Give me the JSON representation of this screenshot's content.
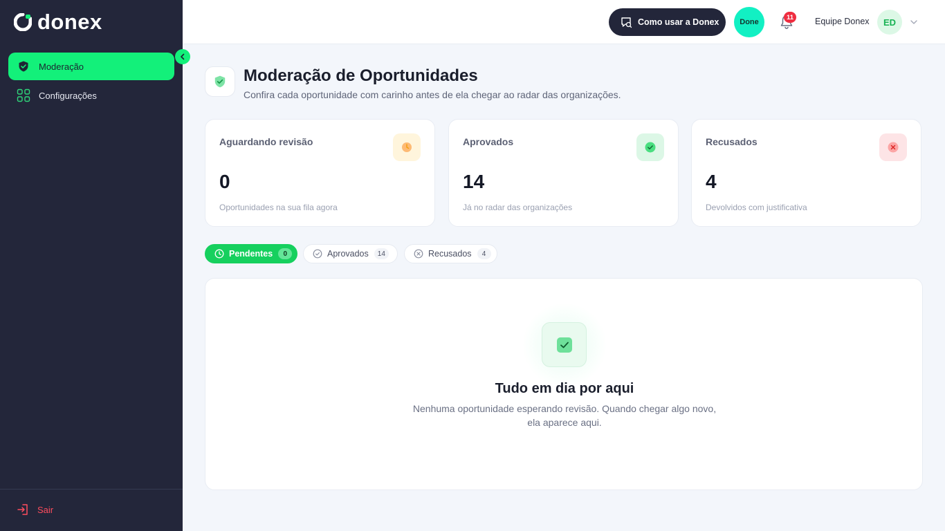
{
  "brand": {
    "name": "donex",
    "accent": "#13f07a",
    "sidebar_bg": "#23263a"
  },
  "sidebar": {
    "items": [
      {
        "label": "Moderação",
        "icon": "shield-check-icon",
        "active": true
      },
      {
        "label": "Configurações",
        "icon": "grid-icon",
        "active": false
      }
    ],
    "logout_label": "Sair"
  },
  "topbar": {
    "howto_label": "Como usar a Donex",
    "done_label": "Done",
    "notifications_count": "11",
    "team_name": "Equipe Donex",
    "team_initials": "ED"
  },
  "page": {
    "title": "Moderação de Oportunidades",
    "subtitle": "Confira cada oportunidade com carinho antes de ela chegar ao radar das organizações."
  },
  "stats": [
    {
      "title": "Aguardando revisão",
      "value": "0",
      "caption": "Oportunidades na sua fila agora",
      "icon": "clock-icon",
      "color": "#f59e0b"
    },
    {
      "title": "Aprovados",
      "value": "14",
      "caption": "Já no radar das organizações",
      "icon": "check-circle-icon",
      "color": "#22c55e"
    },
    {
      "title": "Recusados",
      "value": "4",
      "caption": "Devolvidos com justificativa",
      "icon": "x-circle-icon",
      "color": "#ef4444"
    }
  ],
  "tabs": [
    {
      "label": "Pendentes",
      "count": "0",
      "icon": "clock-icon",
      "active": true
    },
    {
      "label": "Aprovados",
      "count": "14",
      "icon": "check-circle-icon",
      "active": false
    },
    {
      "label": "Recusados",
      "count": "4",
      "icon": "x-circle-icon",
      "active": false
    }
  ],
  "empty_state": {
    "title": "Tudo em dia por aqui",
    "text": "Nenhuma oportunidade esperando revisão. Quando chegar algo novo, ela aparece aqui.",
    "icon": "check-square-icon"
  }
}
